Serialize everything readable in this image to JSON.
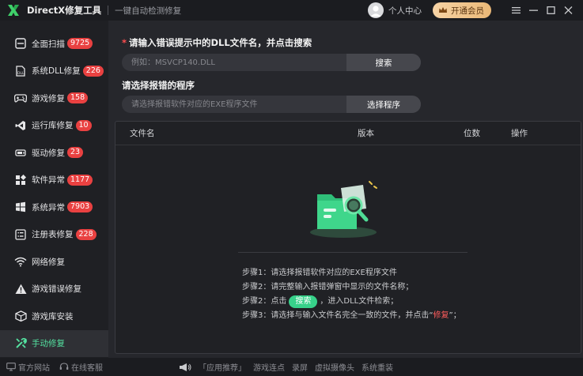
{
  "titlebar": {
    "app_title": "DirectX修复工具",
    "subtitle": "一键自动检测修复",
    "user_center": "个人中心",
    "vip_label": "开通会员"
  },
  "sidebar": {
    "items": [
      {
        "label": "全面扫描",
        "badge": "9725",
        "icon": "scan-icon"
      },
      {
        "label": "系统DLL修复",
        "badge": "226",
        "icon": "dll-icon"
      },
      {
        "label": "游戏修复",
        "badge": "158",
        "icon": "gamepad-icon"
      },
      {
        "label": "运行库修复",
        "badge": "10",
        "icon": "visual-studio-icon"
      },
      {
        "label": "驱动修复",
        "badge": "23",
        "icon": "driver-icon"
      },
      {
        "label": "软件异常",
        "badge": "1177",
        "icon": "apps-grid-icon"
      },
      {
        "label": "系统异常",
        "badge": "7903",
        "icon": "windows-icon"
      },
      {
        "label": "注册表修复",
        "badge": "228",
        "icon": "registry-icon"
      },
      {
        "label": "网络修复",
        "badge": "",
        "icon": "wifi-icon"
      },
      {
        "label": "游戏错误修复",
        "badge": "",
        "icon": "warning-icon"
      },
      {
        "label": "游戏库安装",
        "badge": "",
        "icon": "box-icon"
      },
      {
        "label": "手动修复",
        "badge": "",
        "icon": "tools-icon",
        "active": true
      }
    ]
  },
  "main": {
    "dll_prompt_star": "*",
    "dll_prompt": "请输入错误提示中的DLL文件名，并点击搜索",
    "dll_placeholder": "例如：MSVCP140.DLL",
    "search_label": "搜索",
    "exe_prompt": "请选择报错的程序",
    "exe_placeholder": "请选择报错软件对应的EXE程序文件",
    "select_program_label": "选择程序"
  },
  "table": {
    "columns": [
      "文件名",
      "版本",
      "位数",
      "操作"
    ]
  },
  "steps": {
    "step1": "步骤1：请选择报错软件对应的EXE程序文件",
    "step2a": "步骤2：请完整输入报错弹窗中显示的文件名称；",
    "step2b_prefix": "步骤2：点击",
    "step2b_pill": "搜索",
    "step2b_suffix": "，进入DLL文件检索；",
    "step3_prefix": "步骤3：请选择与输入文件名完全一致的文件，并点击“",
    "step3_red": "修复",
    "step3_suffix": "”；"
  },
  "footer": {
    "website": "官方网站",
    "online_service": "在线客服",
    "recommend": "「应用推荐」",
    "ad_items": [
      "游戏连点",
      "录屏",
      "虚拟摄像头",
      "系统重装"
    ]
  },
  "colors": {
    "accent_green": "#37d18a",
    "badge_red": "#e94141",
    "vip_gold": "#eab877"
  }
}
